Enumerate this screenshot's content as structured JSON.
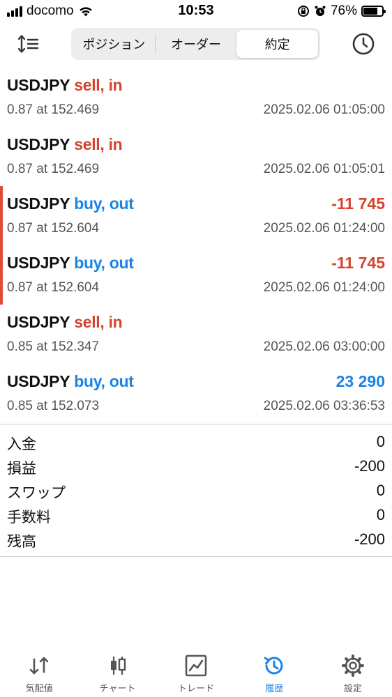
{
  "status_bar": {
    "carrier": "docomo",
    "time": "10:53",
    "battery": "76%",
    "battery_level": 0.76
  },
  "segments": [
    {
      "label": "ポジション",
      "active": false
    },
    {
      "label": "オーダー",
      "active": false
    },
    {
      "label": "約定",
      "active": true
    }
  ],
  "deals": [
    {
      "symbol": "USDJPY",
      "side": "sell, in",
      "side_color": "red",
      "volume_price": "0.87 at 152.469",
      "time": "2025.02.06 01:05:00",
      "profit": "",
      "profit_color": ""
    },
    {
      "symbol": "USDJPY",
      "side": "sell, in",
      "side_color": "red",
      "volume_price": "0.87 at 152.469",
      "time": "2025.02.06 01:05:01",
      "profit": "",
      "profit_color": ""
    },
    {
      "symbol": "USDJPY",
      "side": "buy, out",
      "side_color": "blue",
      "volume_price": "0.87 at 152.604",
      "time": "2025.02.06 01:24:00",
      "profit": "-11 745",
      "profit_color": "red"
    },
    {
      "symbol": "USDJPY",
      "side": "buy, out",
      "side_color": "blue",
      "volume_price": "0.87 at 152.604",
      "time": "2025.02.06 01:24:00",
      "profit": "-11 745",
      "profit_color": "red"
    },
    {
      "symbol": "USDJPY",
      "side": "sell, in",
      "side_color": "red",
      "volume_price": "0.85 at 152.347",
      "time": "2025.02.06 03:00:00",
      "profit": "",
      "profit_color": ""
    },
    {
      "symbol": "USDJPY",
      "side": "buy, out",
      "side_color": "blue",
      "volume_price": "0.85 at 152.073",
      "time": "2025.02.06 03:36:53",
      "profit": "23 290",
      "profit_color": "blue"
    }
  ],
  "summary": [
    {
      "label": "入金",
      "value": "0"
    },
    {
      "label": "損益",
      "value": "-200"
    },
    {
      "label": "スワップ",
      "value": "0"
    },
    {
      "label": "手数料",
      "value": "0"
    },
    {
      "label": "残高",
      "value": "-200"
    }
  ],
  "tabs": [
    {
      "label": "気配値",
      "icon": "quotes-icon",
      "active": false
    },
    {
      "label": "チャート",
      "icon": "chart-icon",
      "active": false
    },
    {
      "label": "トレード",
      "icon": "trade-icon",
      "active": false
    },
    {
      "label": "履歴",
      "icon": "history-icon",
      "active": true
    },
    {
      "label": "設定",
      "icon": "settings-icon",
      "active": false
    }
  ],
  "colors": {
    "sell": "#d5442f",
    "buy": "#1a84e6",
    "accent": "#1a84e6",
    "marker": "#e24a3b"
  }
}
